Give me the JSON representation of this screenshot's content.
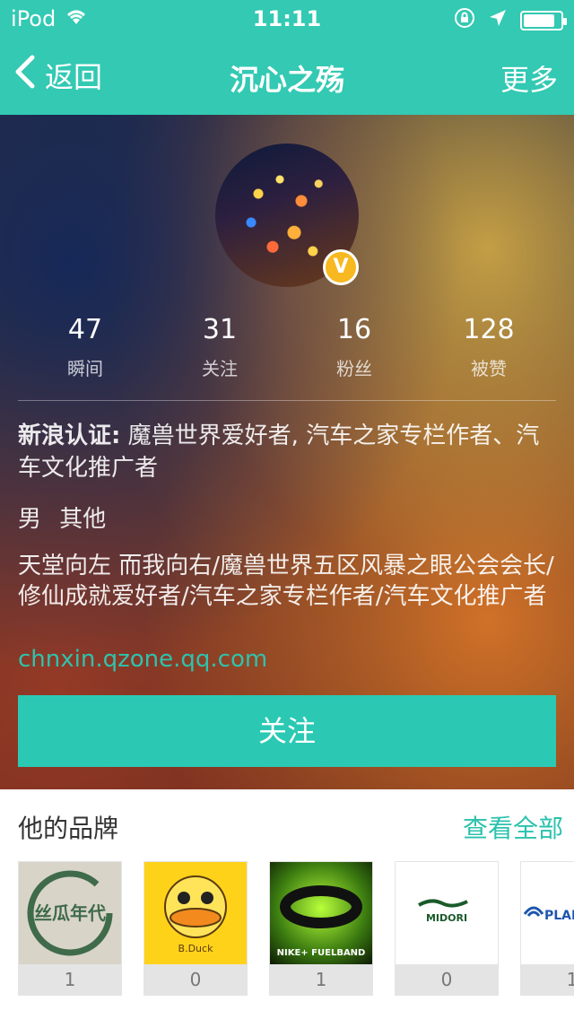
{
  "status_bar": {
    "device": "iPod",
    "time": "11:11",
    "wifi_icon": "wifi-icon",
    "lock_rotation_icon": "lock-rotation-icon",
    "location_icon": "location-arrow-icon",
    "battery_icon": "battery-icon",
    "battery_level": 0.85
  },
  "nav": {
    "back_label": "返回",
    "title": "沉心之殇",
    "more_label": "更多"
  },
  "profile": {
    "verified_badge": "V",
    "stats": [
      {
        "value": "47",
        "label": "瞬间"
      },
      {
        "value": "31",
        "label": "关注"
      },
      {
        "value": "16",
        "label": "粉丝"
      },
      {
        "value": "128",
        "label": "被赞"
      }
    ],
    "certification_label": "新浪认证:",
    "certification_text": "魔兽世界爱好者, 汽车之家专栏作者、汽车文化推广者",
    "gender_location": "男 其他",
    "bio": "天堂向左 而我向右/魔兽世界五区风暴之眼公会会长/修仙成就爱好者/汽车之家专栏作者/汽车文化推广者",
    "url": "chnxin.qzone.qq.com",
    "follow_button": "关注"
  },
  "brands": {
    "title": "他的品牌",
    "see_all": "查看全部",
    "items": [
      {
        "logo_text": "丝瓜年代",
        "count": "1"
      },
      {
        "logo_text": "B.Duck",
        "count": "0"
      },
      {
        "logo_text": "NIKE+ FUELBAND",
        "count": "1"
      },
      {
        "logo_text": "MIDORI",
        "count": "0"
      },
      {
        "logo_text": "PLANT",
        "count": "1"
      }
    ]
  },
  "colors": {
    "accent": "#33c9b3",
    "button": "#2bc9b4",
    "link": "#2fc2ac",
    "badge": "#f7b820"
  }
}
